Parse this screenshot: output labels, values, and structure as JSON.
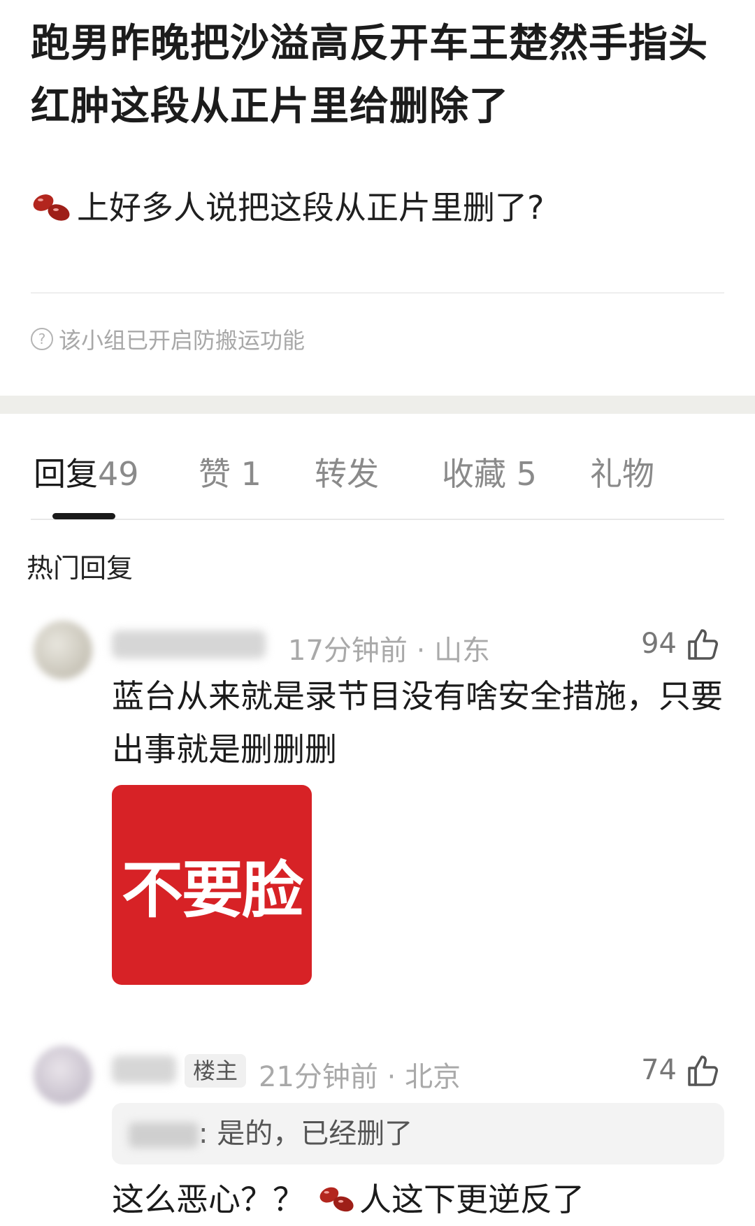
{
  "post": {
    "title": "跑男昨晚把沙溢高反开车王楚然手指头红肿这段从正片里给删除了",
    "body": "上好多人说把这段从正片里删了?",
    "anti_repost_notice": "该小组已开启防搬运功能"
  },
  "tabs": [
    {
      "label": "回复",
      "count": "49"
    },
    {
      "label": "赞",
      "count": "1"
    },
    {
      "label": "转发",
      "count": ""
    },
    {
      "label": "收藏",
      "count": "5"
    },
    {
      "label": "礼物",
      "count": ""
    }
  ],
  "section_label": "热门回复",
  "comments": [
    {
      "time": "17分钟前",
      "location": "山东",
      "likes": "94",
      "text": "蓝台从来就是录节目没有啥安全措施，只要出事就是删删删",
      "sticker_text": "不要脸"
    },
    {
      "badge": "楼主",
      "time": "21分钟前",
      "location": "北京",
      "likes": "74",
      "quote_text": ": 是的，已经删了",
      "text_before_icon": "这么恶心？？",
      "text_after_icon": "人这下更逆反了"
    }
  ],
  "icons": [
    "red-bean-icon",
    "help-circle-icon",
    "thumbs-up-icon"
  ],
  "colors": {
    "sticker_red": "#d72226",
    "muted_text": "#a9a9a9",
    "section_gap": "#eeeeea"
  }
}
